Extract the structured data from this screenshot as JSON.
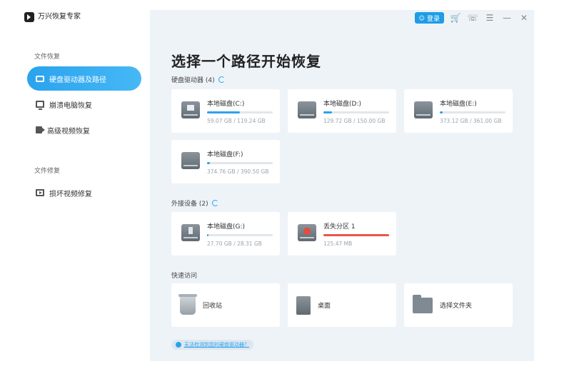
{
  "app": {
    "title": "万兴恢复专家"
  },
  "topbar": {
    "login_label": "登录"
  },
  "sidebar": {
    "file_recovery_label": "文件恢复",
    "file_repair_label": "文件修复",
    "items": [
      {
        "label": "硬盘驱动器及路径"
      },
      {
        "label": "崩溃电脑恢复"
      },
      {
        "label": "高级视频恢复"
      },
      {
        "label": "损坏视频修复"
      }
    ]
  },
  "main": {
    "title": "选择一个路径开始恢复",
    "hard_drives_label": "硬盘驱动器 (4)",
    "external_label": "外接设备 (2)",
    "quick_label": "快速访问",
    "help_link": "无法检测到您的硬盘驱动器？"
  },
  "drives": [
    {
      "name": "本地磁盘(C:)",
      "size": "59.07 GB / 119.24 GB",
      "used": 0.5
    },
    {
      "name": "本地磁盘(D:)",
      "size": "129.72 GB / 150.00 GB",
      "used": 0.13
    },
    {
      "name": "本地磁盘(E:)",
      "size": "373.12 GB / 361.00 GB",
      "used": 0.04
    },
    {
      "name": "本地磁盘(F:)",
      "size": "374.76 GB / 390.50 GB",
      "used": 0.04
    }
  ],
  "external": [
    {
      "name": "本地磁盘(G:)",
      "size": "27.70 GB / 28.31 GB",
      "used": 0.02
    },
    {
      "name": "丢失分区 1",
      "size": "125.47 MB",
      "used": 1.0
    }
  ],
  "quick": [
    {
      "label": "回收站"
    },
    {
      "label": "桌面"
    },
    {
      "label": "选择文件夹"
    }
  ],
  "colors": {
    "accent": "#2aa3ee",
    "lost_bar": "#e8564a",
    "cart": "#f08a1c"
  }
}
